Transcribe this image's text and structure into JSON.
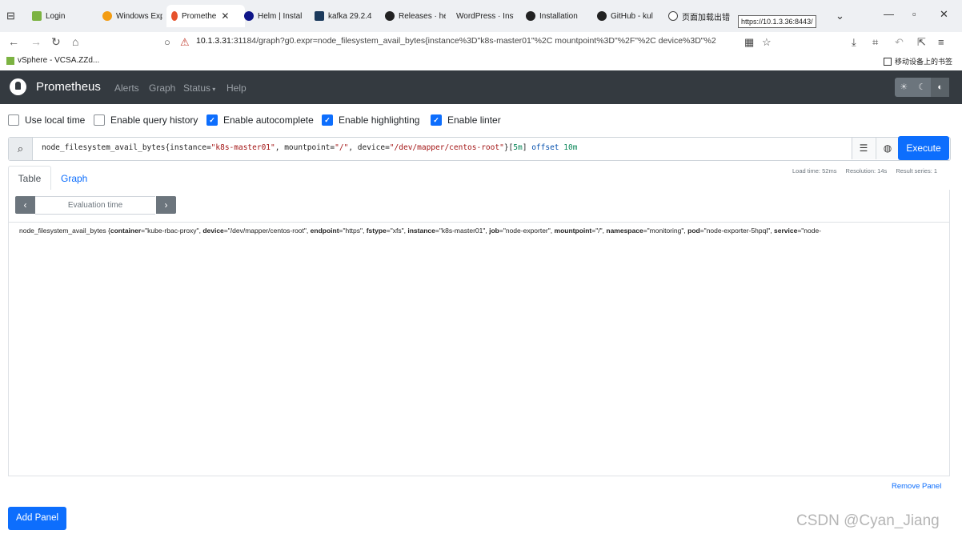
{
  "browser": {
    "tabs": [
      {
        "label": "Login",
        "active": false
      },
      {
        "label": "Windows Exp",
        "active": false
      },
      {
        "label": "Promethe",
        "active": true
      },
      {
        "label": "Helm | Instal",
        "active": false
      },
      {
        "label": "kafka 29.2.4",
        "active": false
      },
      {
        "label": "Releases · he",
        "active": false
      },
      {
        "label": "WordPress · Inst",
        "active": false
      },
      {
        "label": "Installation",
        "active": false
      },
      {
        "label": "GitHub - kul",
        "active": false
      },
      {
        "label": "页面加载出错",
        "active": false
      }
    ],
    "tooltip": "https://10.1.3.36:8443/",
    "url_host": "10.1.3.31",
    "url_rest": ":31184/graph?g0.expr=node_filesystem_avail_bytes{instance%3D\"k8s-master01\"%2C mountpoint%3D\"%2F\"%2C device%3D\"%2",
    "bookmark_left": "vSphere - VCSA.ZZd...",
    "bookmark_right": "移动设备上的书签"
  },
  "navbar": {
    "brand": "Prometheus",
    "links": [
      "Alerts",
      "Graph",
      "Status",
      "Help"
    ],
    "theme_icons": [
      "sun-icon",
      "moon-icon",
      "half-circle-icon"
    ]
  },
  "options": [
    {
      "label": "Use local time",
      "checked": false
    },
    {
      "label": "Enable query history",
      "checked": false
    },
    {
      "label": "Enable autocomplete",
      "checked": true
    },
    {
      "label": "Enable highlighting",
      "checked": true
    },
    {
      "label": "Enable linter",
      "checked": true
    }
  ],
  "expression": {
    "metric": "node_filesystem_avail_bytes",
    "k1": "instance",
    "v1": "\"k8s-master01\"",
    "k2": "mountpoint",
    "v2": "\"/\"",
    "k3": "device",
    "v3": "\"/dev/mapper/centos-root\"",
    "range": "5m",
    "offset_kw": "offset",
    "offset_val": "10m"
  },
  "execute_label": "Execute",
  "panel_tabs": [
    "Table",
    "Graph"
  ],
  "stats": {
    "load_time": "Load time: 52ms",
    "resolution": "Resolution: 14s",
    "result_series": "Result series: 1"
  },
  "eval_time_placeholder": "Evaluation time",
  "result": {
    "metric": "node_filesystem_avail_bytes",
    "labels": [
      {
        "k": "container",
        "v": "\"kube-rbac-proxy\""
      },
      {
        "k": "device",
        "v": "\"/dev/mapper/centos-root\""
      },
      {
        "k": "endpoint",
        "v": "\"https\""
      },
      {
        "k": "fstype",
        "v": "\"xfs\""
      },
      {
        "k": "instance",
        "v": "\"k8s-master01\""
      },
      {
        "k": "job",
        "v": "\"node-exporter\""
      },
      {
        "k": "mountpoint",
        "v": "\"/\""
      },
      {
        "k": "namespace",
        "v": "\"monitoring\""
      },
      {
        "k": "pod",
        "v": "\"node-exporter-5hpql\""
      },
      {
        "k": "service",
        "v": "\"node-"
      }
    ]
  },
  "remove_panel": "Remove Panel",
  "add_panel": "Add Panel",
  "watermark": "CSDN @Cyan_Jiang",
  "colors": {
    "navbar": "#343a40",
    "primary": "#0d6efd",
    "tabbar": "#eef0f3"
  }
}
